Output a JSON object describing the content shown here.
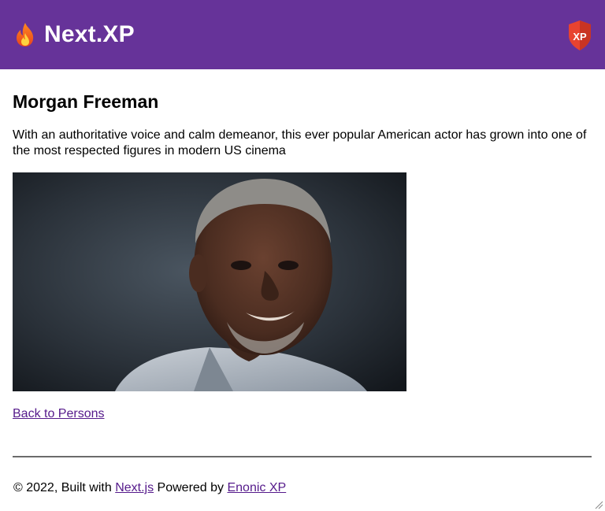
{
  "header": {
    "flame_icon": "flame-emoji-icon",
    "brand": "Next.XP",
    "logo_text": "XP",
    "colors": {
      "background": "#663399",
      "logo_red": "#e8432f"
    }
  },
  "main": {
    "name": "Morgan Freeman",
    "bio": "With an authoritative voice and calm demeanor, this ever popular American actor has grown into one of the most respected figures in modern US cinema",
    "back_link": "Back to Persons"
  },
  "footer": {
    "prefix": "© 2022, Built with ",
    "nextjs": "Next.js",
    "middle": " Powered by ",
    "enonic": "Enonic XP"
  },
  "colors": {
    "link": "#551a8b"
  }
}
